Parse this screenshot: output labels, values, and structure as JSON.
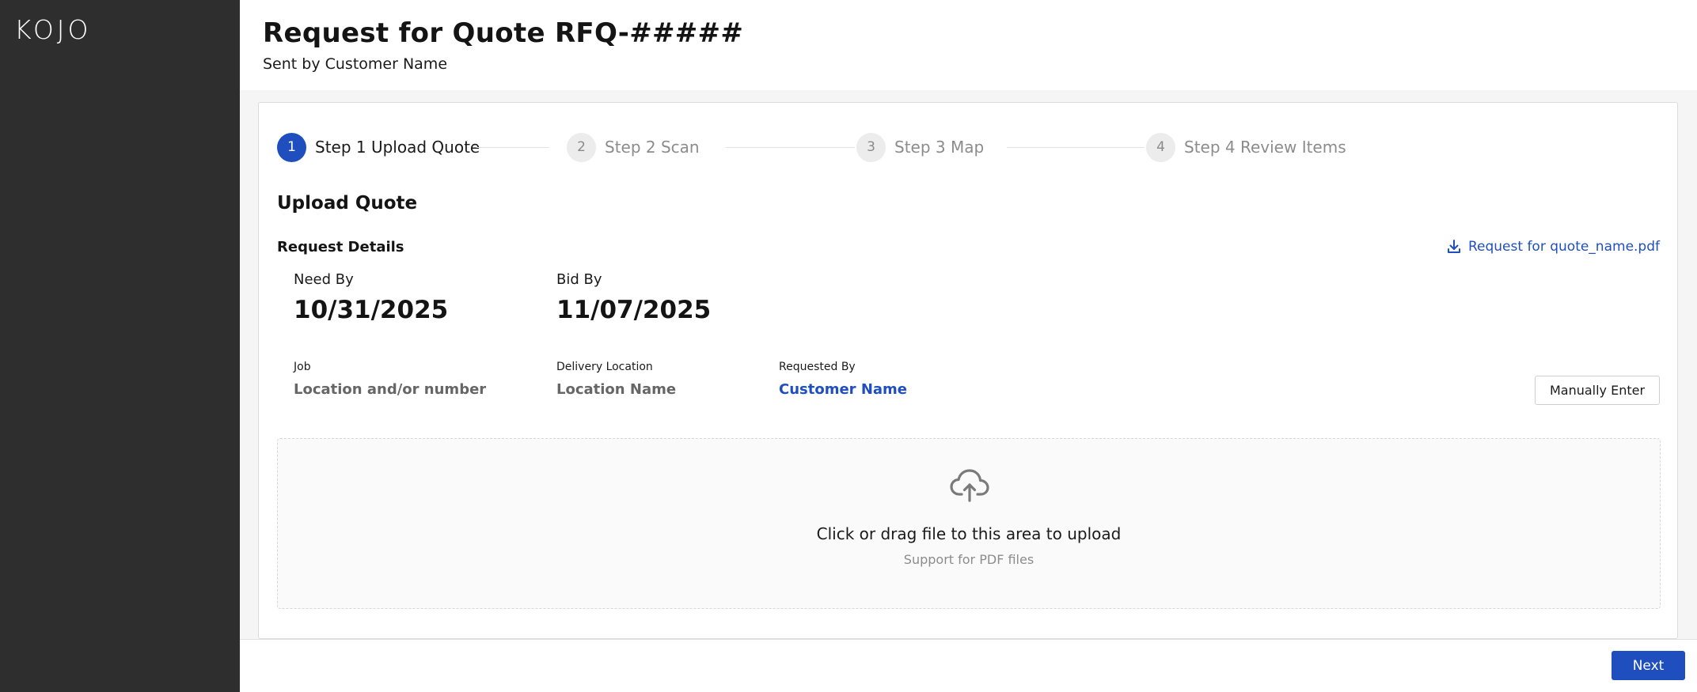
{
  "app": {
    "logo": "KOJO"
  },
  "header": {
    "title": "Request for Quote RFQ-#####",
    "subtitle": "Sent by Customer Name"
  },
  "steps": [
    {
      "number": "1",
      "label": "Step 1 Upload Quote",
      "state": "active"
    },
    {
      "number": "2",
      "label": "Step 2 Scan",
      "state": "inactive"
    },
    {
      "number": "3",
      "label": "Step 3 Map",
      "state": "inactive"
    },
    {
      "number": "4",
      "label": "Step 4 Review Items",
      "state": "inactive"
    }
  ],
  "upload": {
    "section_title": "Upload Quote",
    "details_title": "Request Details",
    "download_link": "Request for quote_name.pdf",
    "need_by_label": "Need By",
    "need_by_value": "10/31/2025",
    "bid_by_label": "Bid By",
    "bid_by_value": "11/07/2025",
    "job_label": "Job",
    "job_value": "Location and/or number",
    "delivery_label": "Delivery Location",
    "delivery_value": "Location Name",
    "requested_label": "Requested By",
    "requested_value": "Customer Name",
    "manual_button": "Manually Enter",
    "drop_text": "Click or drag file to this area to upload",
    "drop_hint": "Support for PDF files"
  },
  "footer": {
    "next_label": "Next"
  },
  "colors": {
    "accent": "#1f4fbf",
    "sidebar": "#2e2e2e"
  },
  "icons": {
    "download": "download-icon",
    "upload": "cloud-upload-icon"
  }
}
